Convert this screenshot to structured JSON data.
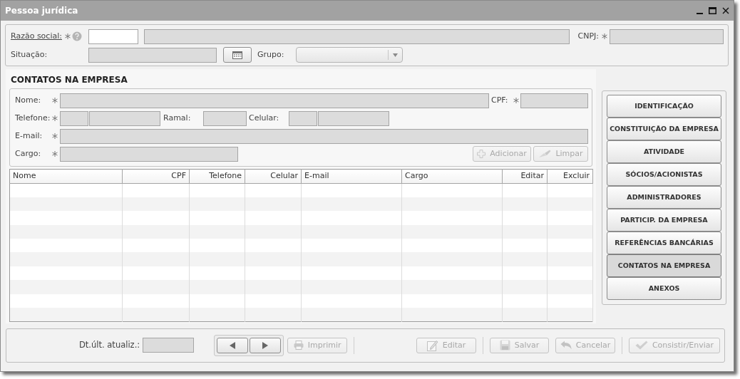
{
  "window": {
    "title": "Pessoa jurídica"
  },
  "company": {
    "razao_social": {
      "label": "Razão social:",
      "required": true,
      "fields": [
        {
          "disabled": false
        },
        {
          "disabled": true
        }
      ]
    },
    "cnpj": {
      "label": "CNPJ:",
      "required": true,
      "disabled": true
    },
    "situacao": {
      "label": "Situação:",
      "disabled": true
    },
    "grupo": {
      "label": "Grupo:",
      "disabled": true
    }
  },
  "contacts": {
    "title": "CONTATOS NA EMPRESA",
    "form": {
      "nome": {
        "label": "Nome:",
        "required": true
      },
      "cpf": {
        "label": "CPF:",
        "required": true
      },
      "telefone": {
        "label": "Telefone:",
        "required": true
      },
      "ramal": {
        "label": "Ramal:"
      },
      "celular": {
        "label": "Celular:"
      },
      "email": {
        "label": "E-mail:",
        "required": true
      },
      "cargo": {
        "label": "Cargo:",
        "required": true
      }
    },
    "buttons": [
      {
        "label": "Adicionar",
        "kind": "add",
        "disabled": true
      },
      {
        "label": "Limpar",
        "kind": "clear",
        "disabled": true
      }
    ],
    "table": {
      "columns": [
        {
          "label": "Nome",
          "kind": "text"
        },
        {
          "label": "CPF",
          "kind": "number"
        },
        {
          "label": "Telefone",
          "kind": "number"
        },
        {
          "label": "Celular",
          "kind": "number"
        },
        {
          "label": "E-mail",
          "kind": "text"
        },
        {
          "label": "Cargo",
          "kind": "text"
        },
        {
          "label": "Editar",
          "kind": "action"
        },
        {
          "label": "Excluir",
          "kind": "action"
        }
      ]
    }
  },
  "sections": [
    {
      "label": "IDENTIFICAÇÃO",
      "selected": false
    },
    {
      "label": "CONSTITUIÇÃO DA EMPRESA",
      "selected": false
    },
    {
      "label": "ATIVIDADE",
      "selected": false
    },
    {
      "label": "SÓCIOS/ACIONISTAS",
      "selected": false
    },
    {
      "label": "ADMINISTRADORES",
      "selected": false
    },
    {
      "label": "PARTICIP. DA EMPRESA",
      "selected": false
    },
    {
      "label": "REFERÊNCIAS BANCÁRIAS",
      "selected": false
    },
    {
      "label": "CONTATOS NA EMPRESA",
      "selected": true
    },
    {
      "label": "ANEXOS",
      "selected": false
    }
  ],
  "footer": {
    "last_update": {
      "label": "Dt.últ. atualiz.:",
      "disabled": true
    },
    "button_groups": [
      [
        {
          "label": "Imprimir",
          "kind": "print",
          "disabled": true
        }
      ],
      [
        {
          "label": "Editar",
          "kind": "edit",
          "disabled": true
        }
      ],
      [
        {
          "label": "Salvar",
          "kind": "save",
          "disabled": true
        },
        {
          "label": "Cancelar",
          "kind": "cancel",
          "disabled": true
        }
      ],
      [
        {
          "label": "Consistir/Enviar",
          "kind": "submit",
          "disabled": true
        }
      ]
    ]
  }
}
